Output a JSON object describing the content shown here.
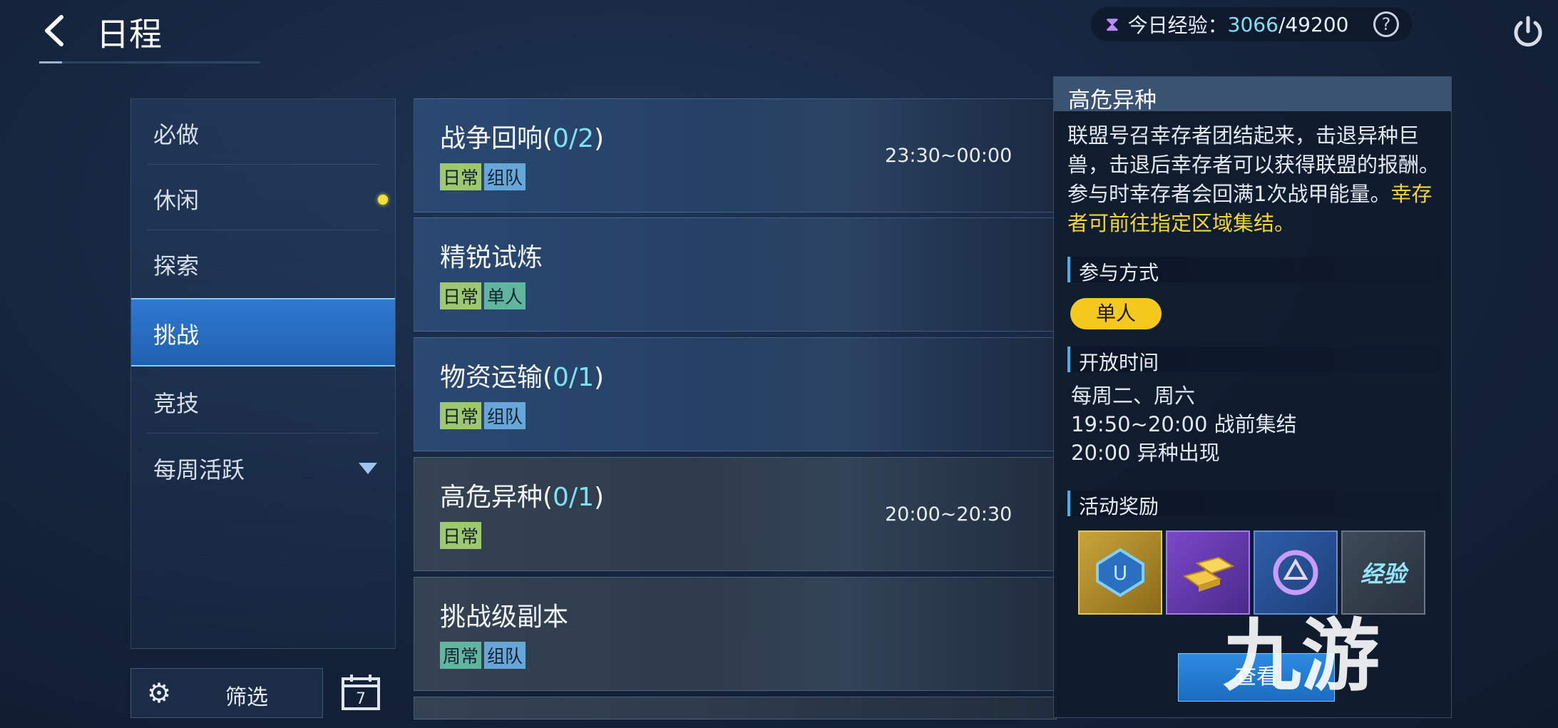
{
  "header": {
    "title": "日程",
    "exp_label": "今日经验：",
    "exp_current": "3066",
    "exp_total": "/49200",
    "help": "?"
  },
  "sidebar": {
    "items": [
      {
        "label": "必做"
      },
      {
        "label": "休闲"
      },
      {
        "label": "探索"
      },
      {
        "label": "挑战"
      },
      {
        "label": "竞技"
      },
      {
        "label": "每周活跃"
      }
    ],
    "active_index": 3,
    "filter_label": "筛选",
    "calendar_day": "7"
  },
  "cards": [
    {
      "name": "战争回响(",
      "count": "0/2",
      "close": ")",
      "time": "23:30~00:00",
      "tags": [
        "日常",
        "组队"
      ]
    },
    {
      "name": "精锐试炼",
      "count": "",
      "close": "",
      "time": "",
      "tags": [
        "日常",
        "单人"
      ]
    },
    {
      "name": "物资运输(",
      "count": "0/1",
      "close": ")",
      "time": "",
      "tags": [
        "日常",
        "组队"
      ]
    },
    {
      "name": "高危异种(",
      "count": "0/1",
      "close": ")",
      "time": "20:00~20:30",
      "tags": [
        "日常"
      ]
    },
    {
      "name": "挑战级副本",
      "count": "",
      "close": "",
      "time": "",
      "tags": [
        "周常",
        "组队"
      ]
    }
  ],
  "detail": {
    "title": "高危异种",
    "desc": "联盟号召幸存者团结起来，击退异种巨兽，击退后幸存者可以获得联盟的报酬。参与时幸存者会回满1次战甲能量。",
    "desc_highlight": "幸存者可前往指定区域集结。",
    "join_header": "参与方式",
    "join_mode": "单人",
    "open_header": "开放时间",
    "open_lines": [
      "每周二、周六",
      "19:50~20:00 战前集结",
      "20:00 异种出现"
    ],
    "reward_header": "活动奖励",
    "reward_text": "经验",
    "view_button": "查看"
  },
  "watermark": "九游",
  "colors": {
    "accent": "#3fb6e8",
    "highlight": "#f4d43a",
    "active_tab": "#2f7ad0",
    "exp_value": "#7ee0f2"
  }
}
